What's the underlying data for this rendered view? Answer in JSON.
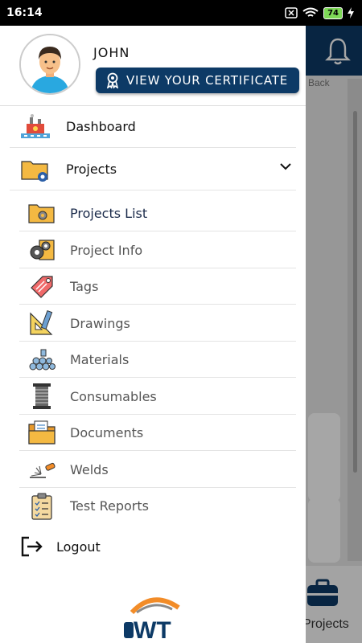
{
  "status_bar": {
    "time": "16:14",
    "battery": "74"
  },
  "background": {
    "back_label": "Back",
    "bottom_tab_label": "Projects"
  },
  "profile": {
    "name": "JOHN",
    "certificate_button": "VIEW YOUR CERTIFICATE"
  },
  "menu": {
    "dashboard": "Dashboard",
    "projects": "Projects",
    "sub_items": [
      {
        "label": "Projects List",
        "icon": "folder-gear-icon"
      },
      {
        "label": "Project Info",
        "icon": "gears-folder-icon"
      },
      {
        "label": "Tags",
        "icon": "tag-icon"
      },
      {
        "label": "Drawings",
        "icon": "drafting-tools-icon"
      },
      {
        "label": "Materials",
        "icon": "pipes-icon"
      },
      {
        "label": "Consumables",
        "icon": "wire-spool-icon"
      },
      {
        "label": "Documents",
        "icon": "documents-folder-icon"
      },
      {
        "label": "Welds",
        "icon": "welding-torch-icon"
      },
      {
        "label": "Test Reports",
        "icon": "clipboard-checklist-icon"
      }
    ],
    "logout": "Logout"
  },
  "colors": {
    "brand": "#0d3a66",
    "logo_orange": "#f28c28"
  }
}
